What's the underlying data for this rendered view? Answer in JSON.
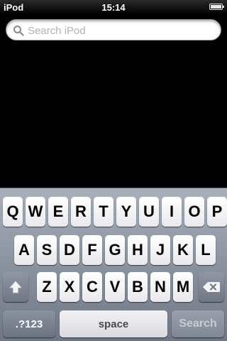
{
  "status_bar": {
    "carrier": "iPod",
    "time": "15:14"
  },
  "search": {
    "placeholder": "Search iPod",
    "value": ""
  },
  "keyboard": {
    "row1": [
      "Q",
      "W",
      "E",
      "R",
      "T",
      "Y",
      "U",
      "I",
      "O",
      "P"
    ],
    "row2": [
      "A",
      "S",
      "D",
      "F",
      "G",
      "H",
      "J",
      "K",
      "L"
    ],
    "row3": [
      "Z",
      "X",
      "C",
      "V",
      "B",
      "N",
      "M"
    ],
    "numbers_label": ".?123",
    "space_label": "space",
    "search_label": "Search",
    "shift_icon": "shift-arrow-icon",
    "delete_icon": "backspace-icon"
  }
}
